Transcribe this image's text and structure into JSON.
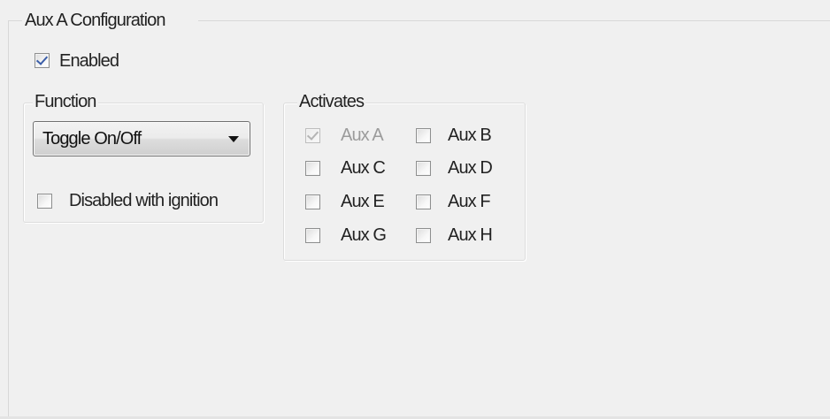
{
  "panel": {
    "title": "Aux A Configuration",
    "enabled": {
      "label": "Enabled",
      "checked": true
    }
  },
  "function_group": {
    "title": "Function",
    "select": {
      "value": "Toggle On/Off"
    },
    "disabled_with_ignition": {
      "label": "Disabled with ignition",
      "checked": false
    }
  },
  "activates_group": {
    "title": "Activates",
    "items": [
      {
        "label": "Aux A",
        "checked": true,
        "disabled": true
      },
      {
        "label": "Aux B",
        "checked": false,
        "disabled": false
      },
      {
        "label": "Aux C",
        "checked": false,
        "disabled": false
      },
      {
        "label": "Aux D",
        "checked": false,
        "disabled": false
      },
      {
        "label": "Aux E",
        "checked": false,
        "disabled": false
      },
      {
        "label": "Aux F",
        "checked": false,
        "disabled": false
      },
      {
        "label": "Aux G",
        "checked": false,
        "disabled": false
      },
      {
        "label": "Aux H",
        "checked": false,
        "disabled": false
      }
    ]
  }
}
